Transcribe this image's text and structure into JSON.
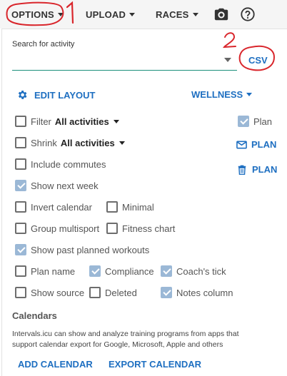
{
  "toolbar": {
    "options_label": "OPTIONS",
    "upload_label": "UPLOAD",
    "races_label": "RACES"
  },
  "search": {
    "label": "Search for activity",
    "value": "",
    "csv_label": "CSV"
  },
  "edit_layout_label": "EDIT LAYOUT",
  "wellness_label": "WELLNESS",
  "filter": {
    "label": "Filter",
    "value": "All activities",
    "checked": false
  },
  "shrink": {
    "label": "Shrink",
    "value": "All activities",
    "checked": false
  },
  "plan": {
    "label": "Plan",
    "checked": true
  },
  "plan_email_label": "PLAN",
  "plan_delete_label": "PLAN",
  "options": [
    {
      "label": "Include commutes",
      "checked": false
    },
    {
      "label": "Show next week",
      "checked": true
    },
    {
      "label": "Invert calendar",
      "checked": false
    },
    {
      "label": "Minimal",
      "checked": false
    },
    {
      "label": "Group multisport",
      "checked": false
    },
    {
      "label": "Fitness chart",
      "checked": false
    },
    {
      "label": "Show past planned workouts",
      "checked": true
    },
    {
      "label": "Plan name",
      "checked": false
    },
    {
      "label": "Compliance",
      "checked": true
    },
    {
      "label": "Coach's tick",
      "checked": true
    },
    {
      "label": "Show source",
      "checked": false
    },
    {
      "label": "Deleted",
      "checked": false
    },
    {
      "label": "Notes column",
      "checked": true
    }
  ],
  "calendars": {
    "title": "Calendars",
    "description": "Intervals.icu can show and analyze training programs from apps that support calendar export for Google, Microsoft, Apple and others",
    "add_label": "ADD CALENDAR",
    "export_label": "EXPORT CALENDAR"
  },
  "annotations": {
    "one": "1",
    "two": "2"
  },
  "colors": {
    "accent": "#1e6fc1",
    "annotation": "#d9262c",
    "checked": "#9bb8d6",
    "underline": "#1b8f7c"
  }
}
